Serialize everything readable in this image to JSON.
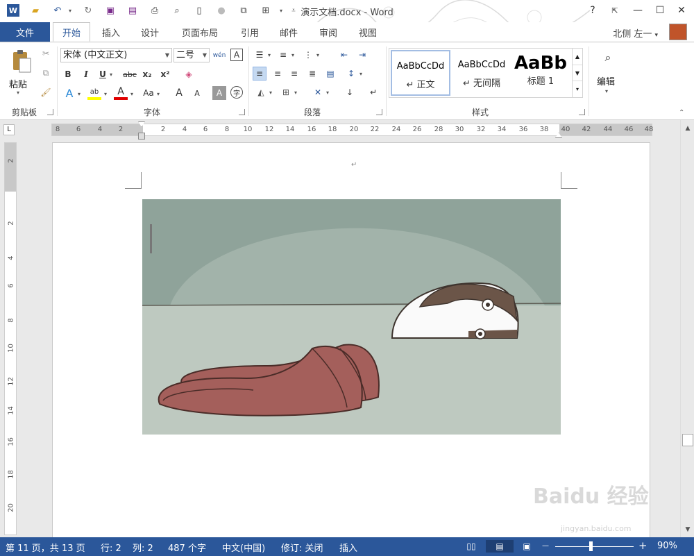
{
  "window": {
    "title": "演示文档.docx - Word",
    "help": "?",
    "ribbon_display": "⇱",
    "minimize": "—",
    "maximize": "☐",
    "close": "✕"
  },
  "qat": [
    "word-icon",
    "open-icon",
    "undo-icon",
    "redo-icon",
    "save-icon",
    "save-as-icon",
    "print-preview-icon",
    "find-icon",
    "new-icon",
    "circle-icon",
    "picture-icon",
    "table-icon",
    "customize-icon"
  ],
  "tabs": {
    "file": "文件",
    "items": [
      "开始",
      "插入",
      "设计",
      "页面布局",
      "引用",
      "邮件",
      "审阅",
      "视图"
    ],
    "active": "开始"
  },
  "user": {
    "name": "北侧 左一",
    "caret": "▾"
  },
  "ribbon": {
    "clipboard": {
      "paste_label": "粘贴",
      "group_label": "剪贴板"
    },
    "font": {
      "font_name": "宋体 (中文正文)",
      "font_size": "二号",
      "phonetic": "wén",
      "group_label": "字体",
      "bold": "B",
      "italic": "I",
      "underline": "U",
      "strike": "abc",
      "subscript": "x₂",
      "superscript": "x²",
      "font_color": "A",
      "case": "Aa",
      "grow": "A",
      "shrink": "A",
      "shade": "A",
      "enclose": "字"
    },
    "paragraph": {
      "group_label": "段落"
    },
    "styles": {
      "group_label": "样式",
      "items": [
        {
          "sample": "AaBbCcDd",
          "name": "↵ 正文"
        },
        {
          "sample": "AaBbCcDd",
          "name": "↵ 无间隔"
        },
        {
          "sample": "AaBb",
          "name": "标题 1"
        }
      ]
    },
    "editing": {
      "label": "编辑"
    }
  },
  "ruler": {
    "tab_stop": "L",
    "numbers": [
      "8",
      "6",
      "4",
      "2",
      "2",
      "4",
      "6",
      "8",
      "10",
      "12",
      "14",
      "16",
      "18",
      "20",
      "22",
      "24",
      "26",
      "28",
      "30",
      "32",
      "34",
      "36",
      "38",
      "40",
      "42",
      "44",
      "46",
      "48"
    ],
    "v_numbers": [
      "2",
      "2",
      "4",
      "6",
      "8",
      "10",
      "12",
      "14",
      "16",
      "18",
      "20"
    ]
  },
  "document": {
    "paragraph_mark": "↵"
  },
  "statusbar": {
    "page": "第 11 页，共 13 页",
    "row": "行: 2",
    "col": "列: 2",
    "words": "487 个字",
    "language": "中文(中国)",
    "track": "修订: 关闭",
    "mode": "插入",
    "zoom_minus": "—",
    "zoom_plus": "+",
    "zoom": "90%"
  },
  "watermark": {
    "logo": "Baidu 经验",
    "url": "jingyan.baidu.com"
  },
  "colors": {
    "accent": "#2b579a",
    "image_wall": "#8fa39a",
    "image_floor": "#bec9c0",
    "slipper": "#a45f5b"
  }
}
